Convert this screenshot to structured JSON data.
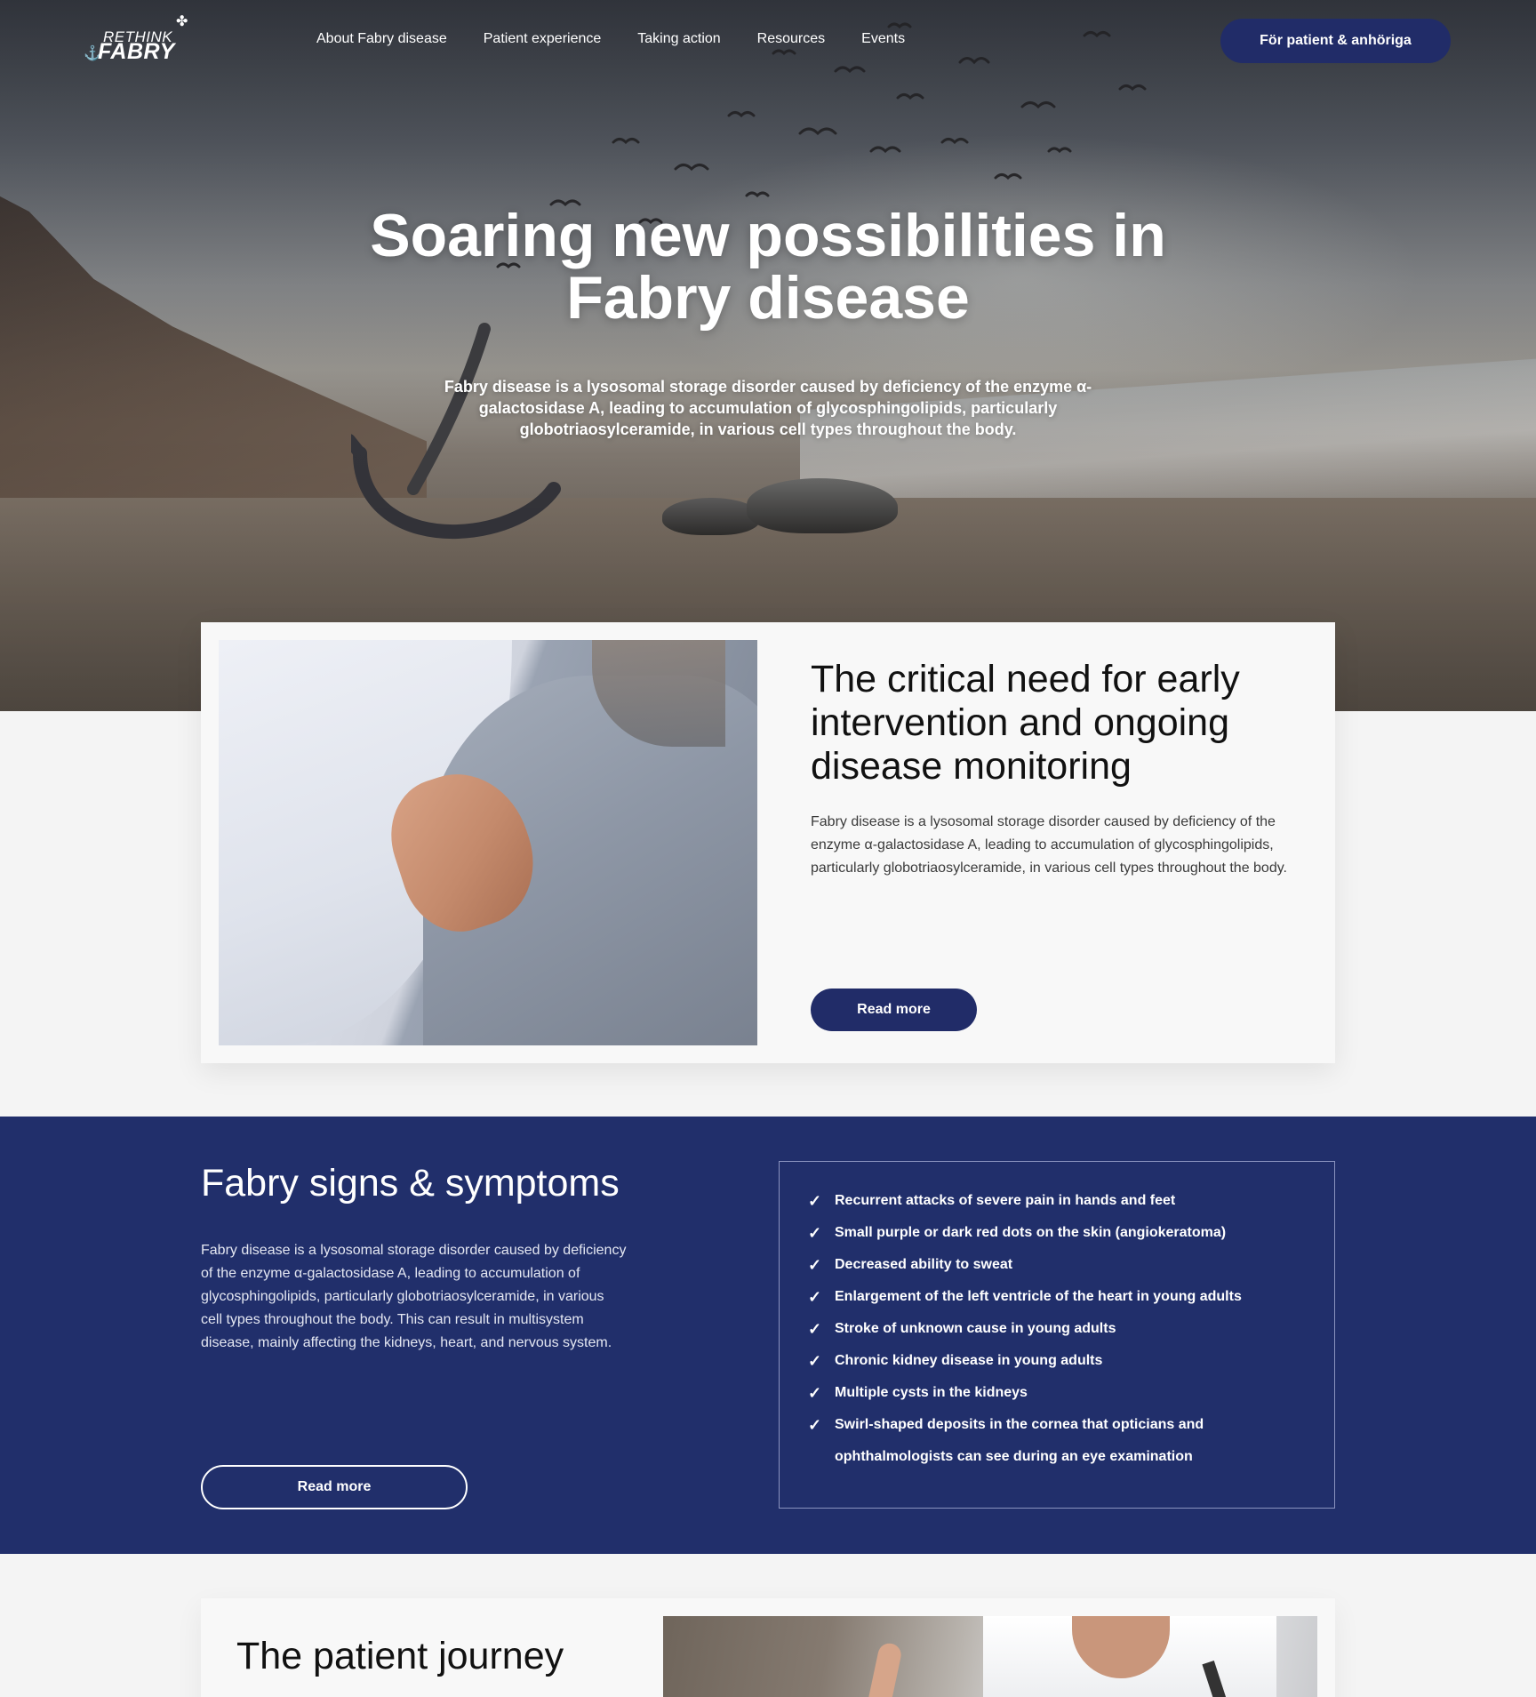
{
  "brand": {
    "logo_line1": "RETHINK",
    "logo_line2": "FABRY"
  },
  "nav": {
    "items": [
      "About Fabry disease",
      "Patient experience",
      "Taking action",
      "Resources",
      "Events"
    ],
    "cta_label": "För patient & anhöriga"
  },
  "hero": {
    "title": "Soaring new possibilities in Fabry disease",
    "subtitle": "Fabry disease is a lysosomal storage disorder caused by deficiency of the enzyme α-galactosidase A, leading to accumulation of glycosphingolipids, particularly globotriaosylceramide, in various cell types throughout the body."
  },
  "intervention": {
    "title": "The critical need for early intervention and ongoing disease monitoring",
    "body": "Fabry disease is a lysosomal storage disorder caused by deficiency of the enzyme α-galactosidase A, leading to accumulation of glycosphingolipids, particularly globotriaosylceramide, in various cell types throughout the body.",
    "button": "Read more"
  },
  "signs": {
    "title": "Fabry signs & symptoms",
    "body": "Fabry disease is a lysosomal storage disorder caused by deficiency of the enzyme α-galactosidase A, leading to accumulation of glycosphingolipids, particularly globotriaosylceramide, in various cell types throughout the body. This can result in multisystem disease, mainly affecting the kidneys, heart, and nervous system.",
    "button": "Read more",
    "symptoms": [
      "Recurrent attacks of severe pain in hands and feet",
      "Small purple or dark red dots on the skin (angiokeratoma)",
      "Decreased ability to sweat",
      "Enlargement of the left ventricle of the heart in young adults",
      "Stroke of unknown cause in young adults",
      "Chronic kidney disease in young adults",
      "Multiple cysts in the kidneys",
      "Swirl-shaped deposits in the cornea that opticians and ophthalmologists can see during an eye examination"
    ]
  },
  "journey": {
    "title": "The patient journey"
  },
  "icons": {
    "check": "check-icon"
  },
  "colors": {
    "brand_navy": "#212c68",
    "section_navy": "#212f6b",
    "page_bg": "#f4f4f4"
  }
}
